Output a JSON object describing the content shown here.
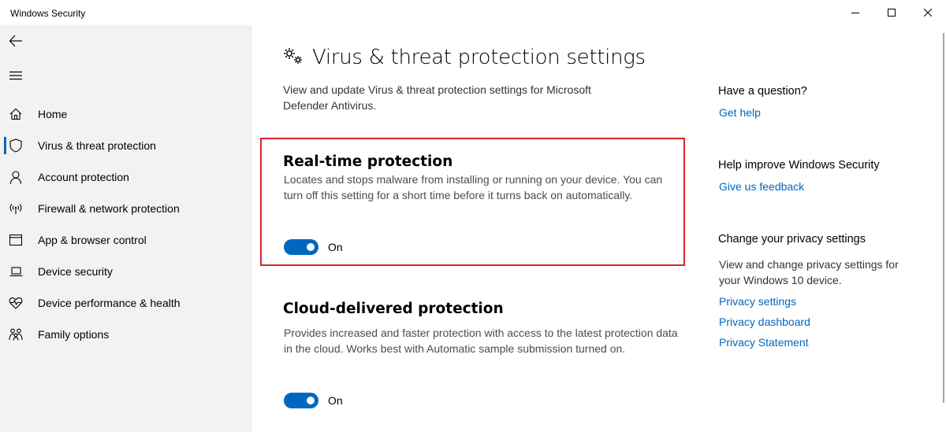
{
  "window": {
    "title": "Windows Security"
  },
  "sidebar": {
    "items": [
      {
        "label": "Home",
        "icon": "home-icon",
        "selected": false
      },
      {
        "label": "Virus & threat protection",
        "icon": "shield-icon",
        "selected": true
      },
      {
        "label": "Account protection",
        "icon": "person-icon",
        "selected": false
      },
      {
        "label": "Firewall & network protection",
        "icon": "wifi-antenna-icon",
        "selected": false
      },
      {
        "label": "App & browser control",
        "icon": "app-window-icon",
        "selected": false
      },
      {
        "label": "Device security",
        "icon": "laptop-icon",
        "selected": false
      },
      {
        "label": "Device performance & health",
        "icon": "heart-pulse-icon",
        "selected": false
      },
      {
        "label": "Family options",
        "icon": "family-icon",
        "selected": false
      }
    ]
  },
  "main": {
    "title": "Virus & threat protection settings",
    "description": "View and update Virus & threat protection settings for Microsoft Defender Antivirus.",
    "sections": [
      {
        "title": "Real-time protection",
        "description": "Locates and stops malware from installing or running on your device. You can turn off this setting for a short time before it turns back on automatically.",
        "toggle_state": "On",
        "enabled": true,
        "highlighted": true
      },
      {
        "title": "Cloud-delivered protection",
        "description": "Provides increased and faster protection with access to the latest protection data in the cloud. Works best with Automatic sample submission turned on.",
        "toggle_state": "On",
        "enabled": true,
        "highlighted": false
      }
    ]
  },
  "right_panel": {
    "question_heading": "Have a question?",
    "get_help": "Get help",
    "improve_heading": "Help improve Windows Security",
    "feedback": "Give us feedback",
    "privacy_heading": "Change your privacy settings",
    "privacy_text": "View and change privacy settings for your Windows 10 device.",
    "privacy_links": [
      "Privacy settings",
      "Privacy dashboard",
      "Privacy Statement"
    ]
  },
  "colors": {
    "accent": "#0067c0",
    "highlight_border": "#d9252a",
    "sidebar_bg": "#f2f2f2"
  }
}
